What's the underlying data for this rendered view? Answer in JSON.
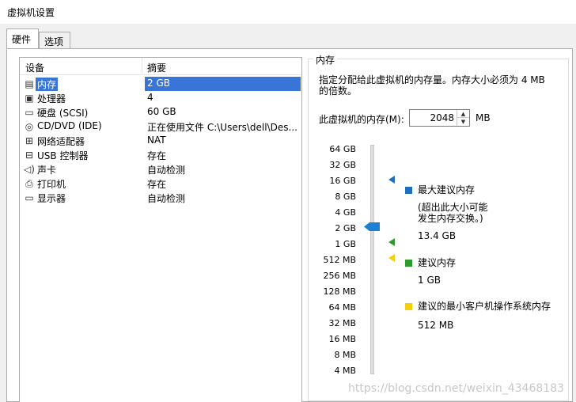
{
  "window": {
    "title": "虚拟机设置"
  },
  "tabs": [
    {
      "label": "硬件"
    },
    {
      "label": "选项"
    }
  ],
  "device_table": {
    "headers": {
      "device": "设备",
      "summary": "摘要"
    },
    "rows": [
      {
        "icon": "memory-icon",
        "glyph": "▤",
        "name": "内存",
        "summary": "2 GB",
        "selected": true
      },
      {
        "icon": "processor-icon",
        "glyph": "▣",
        "name": "处理器",
        "summary": "4"
      },
      {
        "icon": "hard-disk-icon",
        "glyph": "▭",
        "name": "硬盘 (SCSI)",
        "summary": "60 GB"
      },
      {
        "icon": "cd-dvd-icon",
        "glyph": "◎",
        "name": "CD/DVD (IDE)",
        "summary": "正在使用文件 C:\\Users\\dell\\Des..."
      },
      {
        "icon": "network-adapter-icon",
        "glyph": "⊞",
        "name": "网络适配器",
        "summary": "NAT"
      },
      {
        "icon": "usb-controller-icon",
        "glyph": "⊟",
        "name": "USB 控制器",
        "summary": "存在"
      },
      {
        "icon": "sound-card-icon",
        "glyph": "◁)",
        "name": "声卡",
        "summary": "自动检测"
      },
      {
        "icon": "printer-icon",
        "glyph": "⎙",
        "name": "打印机",
        "summary": "存在"
      },
      {
        "icon": "display-icon",
        "glyph": "▭",
        "name": "显示器",
        "summary": "自动检测"
      }
    ]
  },
  "memory": {
    "group_title": "内存",
    "description": "指定分配给此虚拟机的内存量。内存大小必须为 4 MB 的倍数。",
    "field_label": "此虚拟机的内存(M):",
    "value": "2048",
    "unit": "MB",
    "scale_labels": [
      "64 GB",
      "32 GB",
      "16 GB",
      "8 GB",
      "4 GB",
      "2 GB",
      "1 GB",
      "512 MB",
      "256 MB",
      "128 MB",
      "64 MB",
      "32 MB",
      "16 MB",
      "8 MB",
      "4 MB"
    ],
    "slider_value": "2 GB",
    "legend": {
      "max": {
        "title": "最大建议内存",
        "note_line1": "(超出此大小可能",
        "note_line2": "发生内存交换。)",
        "value": "13.4 GB",
        "color": "#1f6fbf"
      },
      "recommended": {
        "title": "建议内存",
        "value": "1 GB",
        "color": "#2e9b2e"
      },
      "min_os": {
        "title": "建议的最小客户机操作系统内存",
        "value": "512 MB",
        "color": "#f2d10a"
      }
    }
  },
  "watermark": "https://blog.csdn.net/weixin_43468183"
}
